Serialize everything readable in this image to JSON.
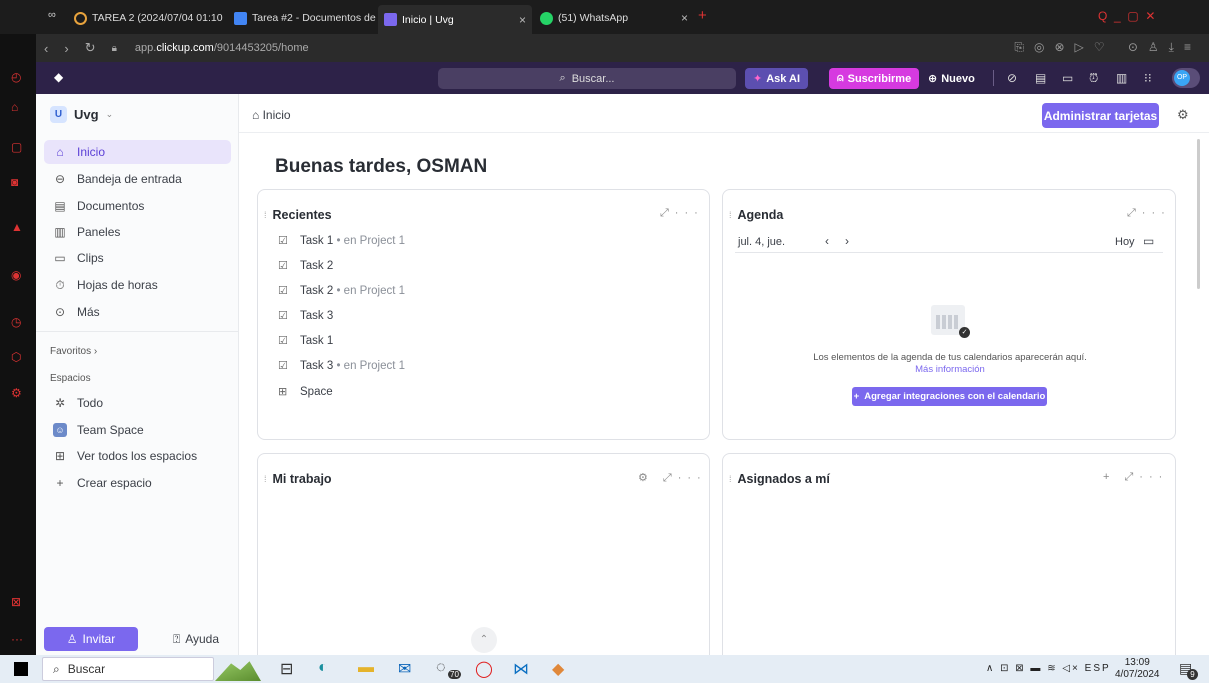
{
  "browser": {
    "tabs": [
      {
        "label": "TAREA 2 (2024/07/04 01:10",
        "color": "#e8a33d"
      },
      {
        "label": "Tarea #2 - Documentos de",
        "color": "#4285f4"
      },
      {
        "label": "Inicio | Uvg",
        "color": "#7b68ee"
      },
      {
        "label": "(51) WhatsApp",
        "color": "#25d366"
      }
    ],
    "close_glyph": "×",
    "new_tab_glyph": "+",
    "url_prefix": "app.",
    "url_domain": "clickup.com",
    "url_path": "/9014453205/home",
    "window_controls": "Q  _  ▢  ✕"
  },
  "topbar": {
    "search_placeholder": "Buscar...",
    "ask_ai": "Ask AI",
    "subscribe": "Suscribirme",
    "new": "Nuevo",
    "avatar": "OP"
  },
  "sidebar": {
    "workspace_badge": "U",
    "workspace_name": "Uvg",
    "items": [
      {
        "label": "Inicio",
        "icon": "home-icon"
      },
      {
        "label": "Bandeja de entrada",
        "icon": "inbox-icon"
      },
      {
        "label": "Documentos",
        "icon": "doc-icon"
      },
      {
        "label": "Paneles",
        "icon": "dashboard-icon"
      },
      {
        "label": "Clips",
        "icon": "clip-icon"
      },
      {
        "label": "Hojas de horas",
        "icon": "timesheet-icon"
      },
      {
        "label": "Más",
        "icon": "more-icon"
      }
    ],
    "favorites_label": "Favoritos ›",
    "spaces_label": "Espacios",
    "spaces": [
      {
        "label": "Todo",
        "icon": "asterisk-icon"
      },
      {
        "label": "Team Space",
        "icon": "team-icon"
      },
      {
        "label": "Ver todos los espacios",
        "icon": "grid-icon"
      },
      {
        "label": "Crear espacio",
        "icon": "plus-icon"
      }
    ],
    "invite": "Invitar",
    "help": "Ayuda"
  },
  "main": {
    "breadcrumb": "Inicio",
    "manage_cards": "Administrar tarjetas",
    "greeting": "Buenas tardes, OSMAN",
    "recents": {
      "title": "Recientes",
      "items": [
        {
          "name": "Task 1",
          "location": "• en Project 1",
          "icon": "task-icon"
        },
        {
          "name": "Task 2",
          "location": "",
          "icon": "task-icon"
        },
        {
          "name": "Task 2",
          "location": "• en Project 1",
          "icon": "task-icon"
        },
        {
          "name": "Task 3",
          "location": "",
          "icon": "task-icon"
        },
        {
          "name": "Task 1",
          "location": "",
          "icon": "task-icon"
        },
        {
          "name": "Task 3",
          "location": "• en Project 1",
          "icon": "task-icon"
        },
        {
          "name": "Space",
          "location": "",
          "icon": "table-icon"
        }
      ]
    },
    "agenda": {
      "title": "Agenda",
      "date": "jul. 4, jue.",
      "today": "Hoy",
      "empty_text": "Los elementos de la agenda de tus calendarios aparecerán aquí.",
      "more_info": "Más información",
      "add_integration": "Agregar integraciones con el calendario"
    },
    "my_work": {
      "title": "Mi trabajo"
    },
    "assigned": {
      "title": "Asignados a mí"
    }
  },
  "taskbar": {
    "search": "Buscar",
    "whatsapp_badge": "70",
    "lang": "ESP",
    "time": "13:09",
    "date": "4/07/2024",
    "notif_count": "9"
  }
}
